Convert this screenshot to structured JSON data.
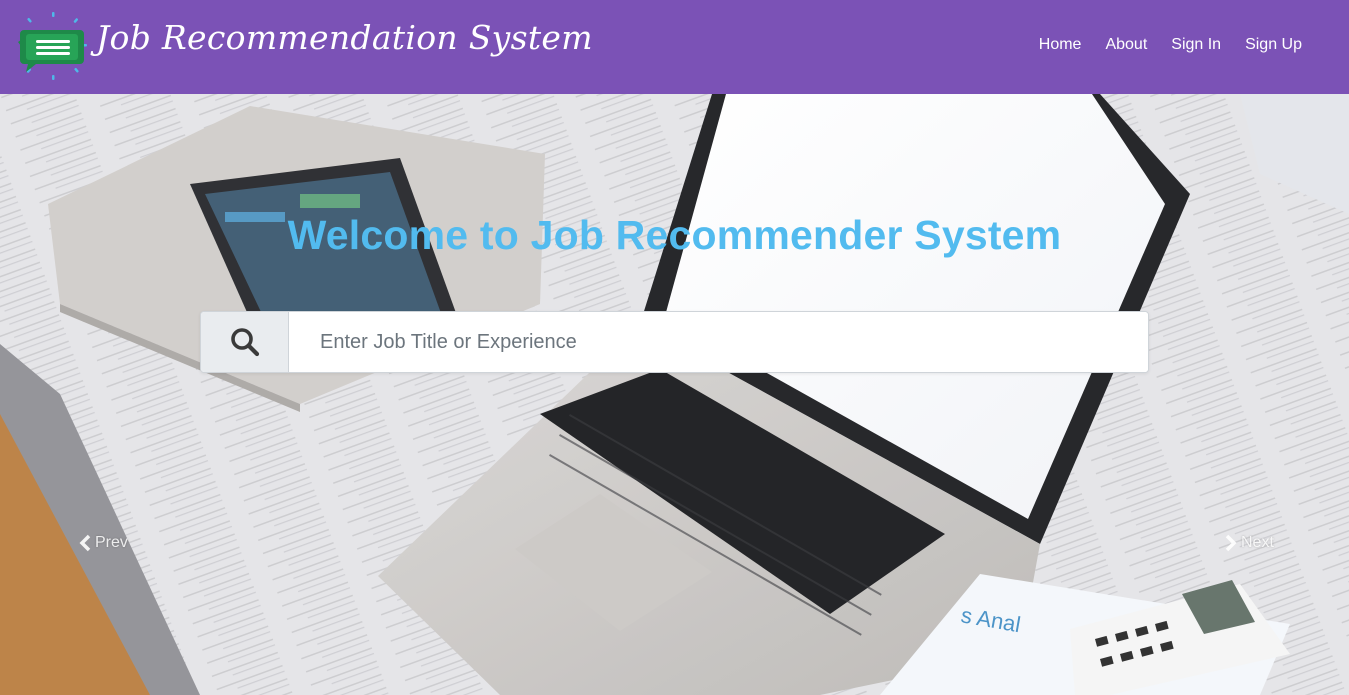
{
  "header": {
    "brand": "Job Recommendation System",
    "nav": [
      "Home",
      "About",
      "Sign In",
      "Sign Up"
    ],
    "color": "#7b52b6"
  },
  "hero": {
    "welcome": "Welcome to Job Recommender System",
    "title_color": "#52bbef",
    "search": {
      "placeholder": "Enter Job Title or Experience",
      "value": ""
    },
    "carousel": {
      "prev": "Prev",
      "next": "Next"
    }
  },
  "icons": {
    "logo": "chat-bubble-menu-icon",
    "search": "search-icon",
    "prev": "chevron-left-icon",
    "next": "chevron-right-icon"
  }
}
